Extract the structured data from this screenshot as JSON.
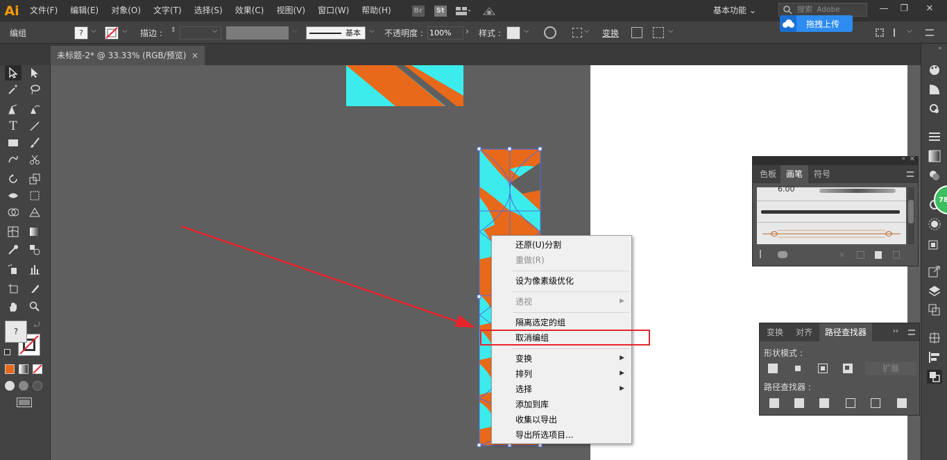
{
  "app": {
    "logo": "Ai",
    "menu": [
      "文件(F)",
      "编辑(E)",
      "对象(O)",
      "文字(T)",
      "选择(S)",
      "效果(C)",
      "视图(V)",
      "窗口(W)",
      "帮助(H)"
    ],
    "bridge_badge": "Br",
    "stock_badge": "St",
    "workspace": "基本功能",
    "search_placeholder": "搜索 Adobe Stock",
    "win_min": "—",
    "win_max": "❐",
    "win_close": "✕"
  },
  "upload": {
    "label": "拖拽上传"
  },
  "control_bar": {
    "selection_type": "编组",
    "stroke_label": "描边 :",
    "brush_label": "基本",
    "opacity_label": "不透明度 :",
    "opacity_value": "100%",
    "style_label": "样式 :",
    "transform_label": "变换"
  },
  "document": {
    "tab_title": "未标题-2* @ 33.33% (RGB/预览)",
    "close": "×"
  },
  "colors": {
    "orange": "#e8691a",
    "cyan": "#3cecec",
    "selection": "#4a6ee0",
    "accent_red": "#e8242b"
  },
  "context_menu": {
    "undo": "还原(U)分割",
    "redo": "重做(R)",
    "pixel": "设为像素级优化",
    "perspective": "透视",
    "isolate": "隔离选定的组",
    "ungroup": "取消编组",
    "transform": "变换",
    "arrange": "排列",
    "select": "选择",
    "add_library": "添加到库",
    "collect_export": "收集以导出",
    "export_selected": "导出所选项目..."
  },
  "brush_panel": {
    "tabs": [
      "色板",
      "画笔",
      "符号"
    ],
    "active_tab": "画笔",
    "first_brush_size": "6.00"
  },
  "pathfinder_panel": {
    "tabs": [
      "变换",
      "对齐",
      "路径查找器"
    ],
    "active_tab": "路径查找器",
    "shape_modes_label": "形状模式 :",
    "expand_label": "扩展",
    "pathfinders_label": "路径查找器 :"
  },
  "badge": {
    "value": "78"
  }
}
